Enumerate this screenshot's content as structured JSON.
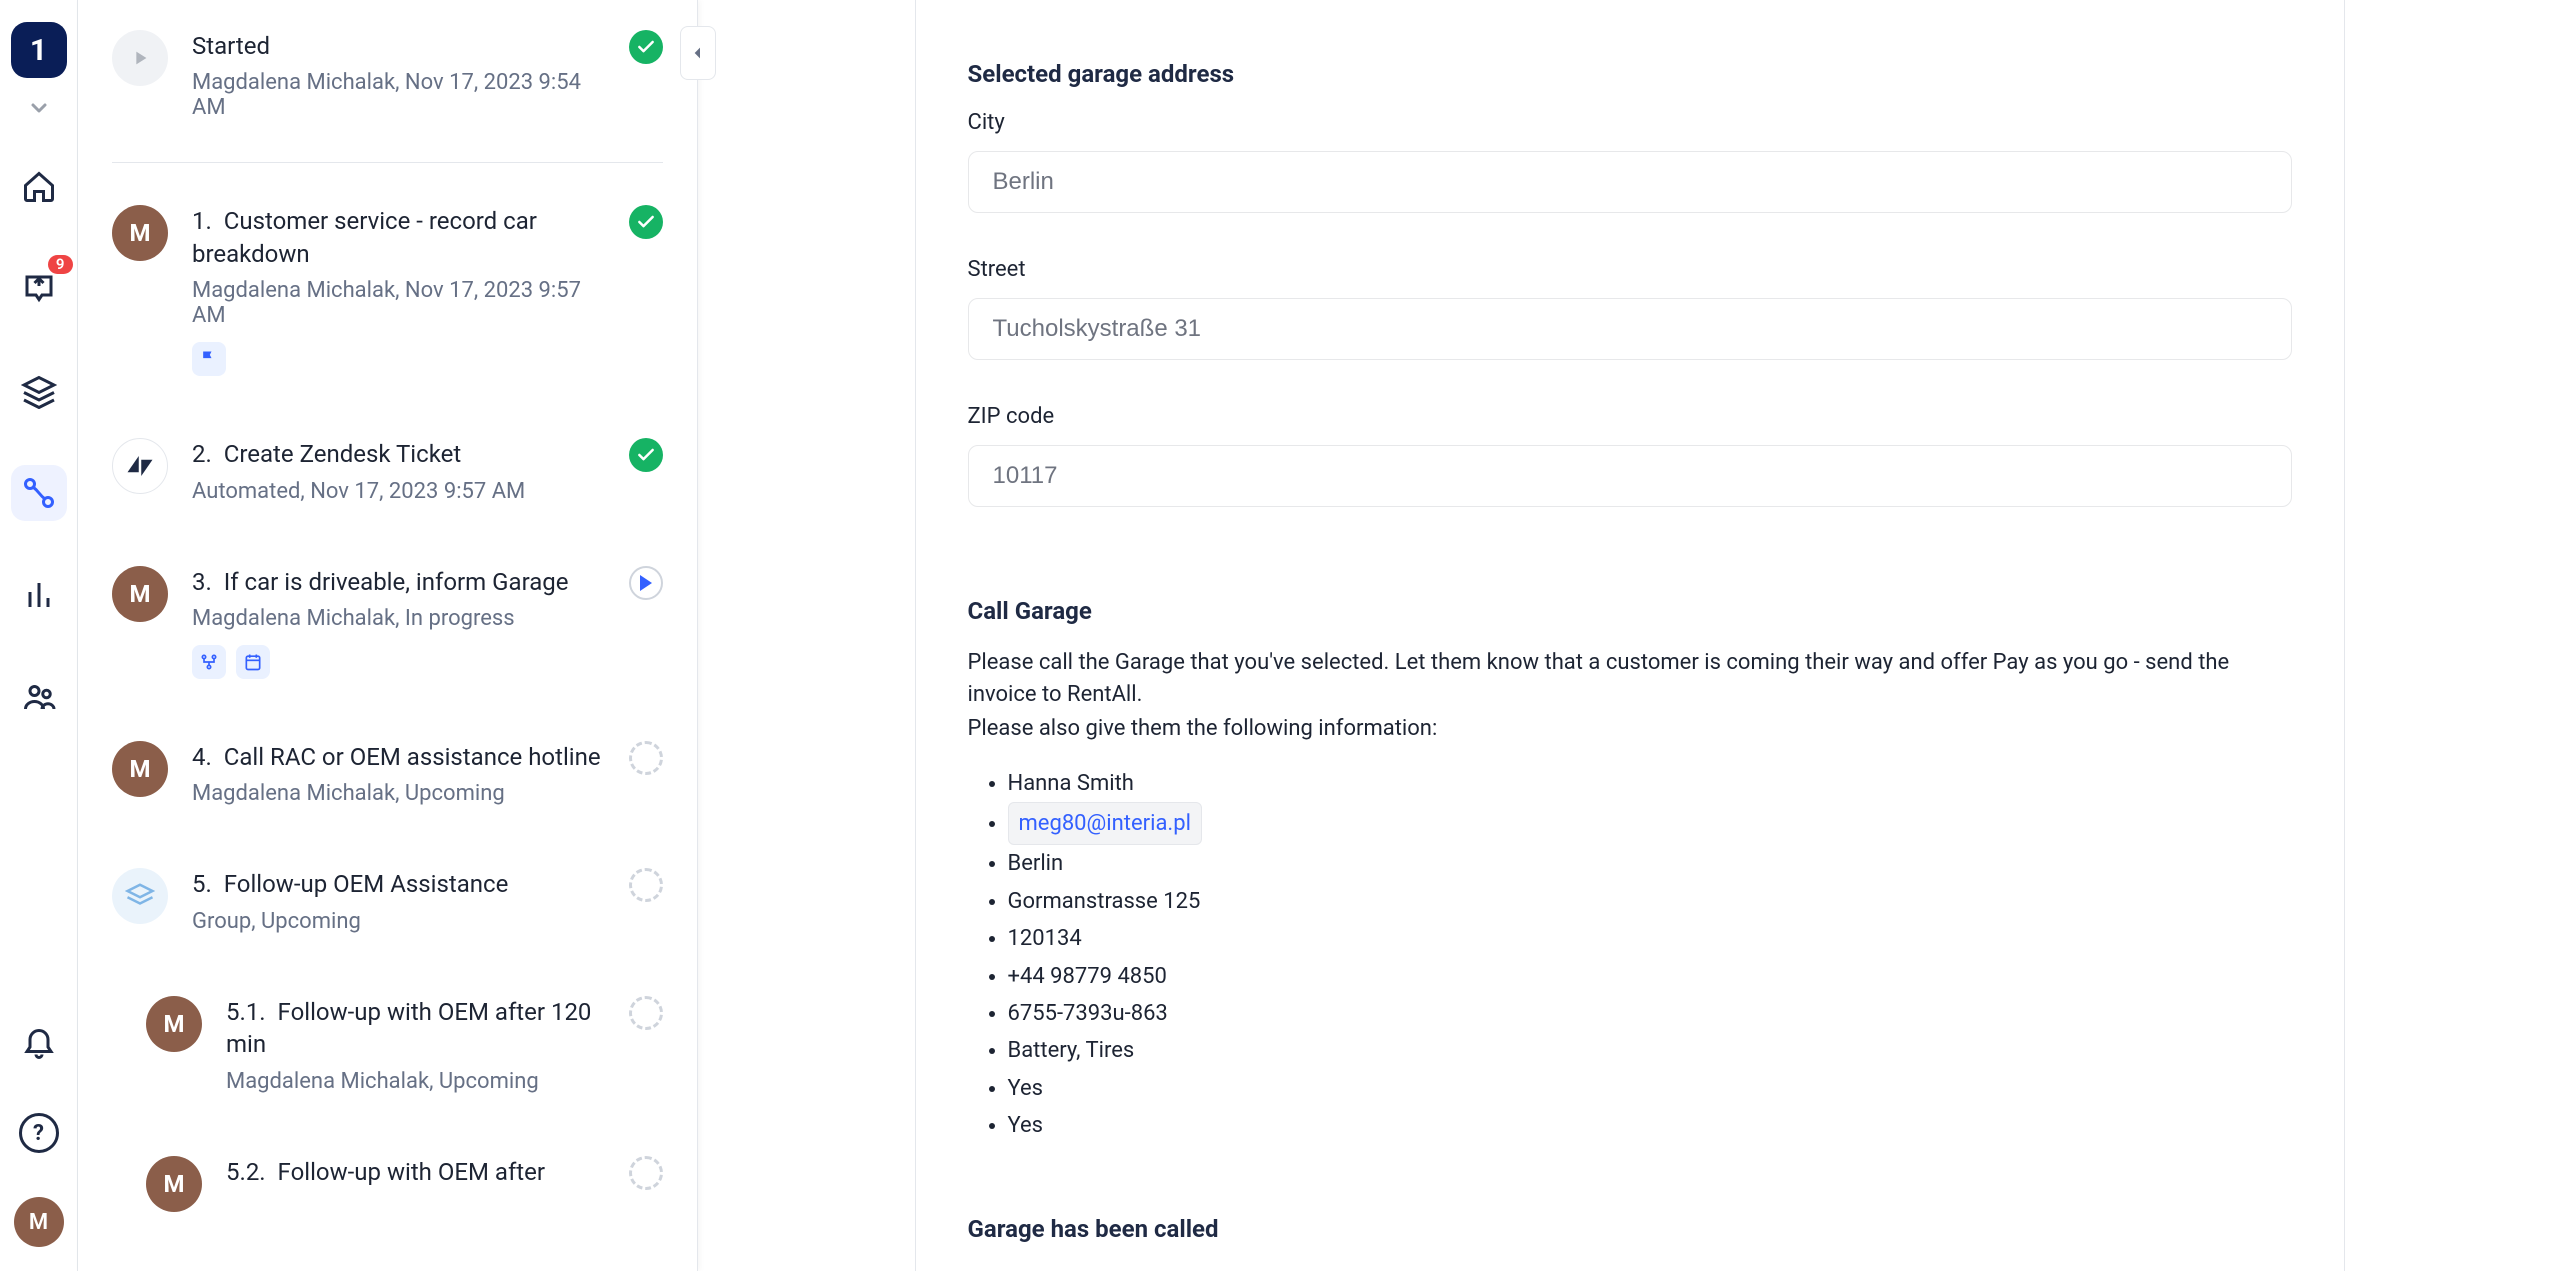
{
  "rail": {
    "workspace_initial": "1",
    "inbox_badge": "9"
  },
  "mid_panel": {
    "tasks": {
      "started": {
        "title": "Started",
        "meta": "Magdalena Michalak, Nov 17, 2023 9:54 AM"
      },
      "t1": {
        "num": "1.",
        "title": "Customer service - record car breakdown",
        "meta": "Magdalena Michalak, Nov 17, 2023 9:57 AM"
      },
      "t2": {
        "num": "2.",
        "title": "Create Zendesk Ticket",
        "meta": "Automated, Nov 17, 2023 9:57 AM"
      },
      "t3": {
        "num": "3.",
        "title": "If car is driveable, inform Garage",
        "meta": "Magdalena Michalak, In progress"
      },
      "t4": {
        "num": "4.",
        "title": "Call RAC or OEM assistance hotline",
        "meta": "Magdalena Michalak, Upcoming"
      },
      "t5": {
        "num": "5.",
        "title": "Follow-up OEM Assistance",
        "meta": "Group, Upcoming"
      },
      "t51": {
        "num": "5.1.",
        "title": "Follow-up with OEM after 120 min",
        "meta": "Magdalena Michalak, Upcoming"
      },
      "t52": {
        "num": "5.2.",
        "title_partial": "Follow-up with OEM after"
      }
    }
  },
  "main": {
    "section_title": "Selected garage address",
    "city": {
      "label": "City",
      "value": "Berlin"
    },
    "street": {
      "label": "Street",
      "value": "Tucholskystraße 31"
    },
    "zip": {
      "label": "ZIP code",
      "value": "10117"
    },
    "call_title": "Call Garage",
    "call_para1": "Please call the Garage that you've selected. Let them know that a customer is coming their way and offer Pay as you go - send the invoice to RentAll.",
    "call_para2": "Please also give them the following information:",
    "info": {
      "name": "Hanna Smith",
      "email": "meg80@interia.pl",
      "city": "Berlin",
      "street": "Gormanstrasse 125",
      "zip": "120134",
      "phone": "+44 98779 4850",
      "ref": "6755-7393u-863",
      "parts": "Battery, Tires",
      "yes1": "Yes",
      "yes2": "Yes"
    },
    "called_title": "Garage has been called"
  }
}
